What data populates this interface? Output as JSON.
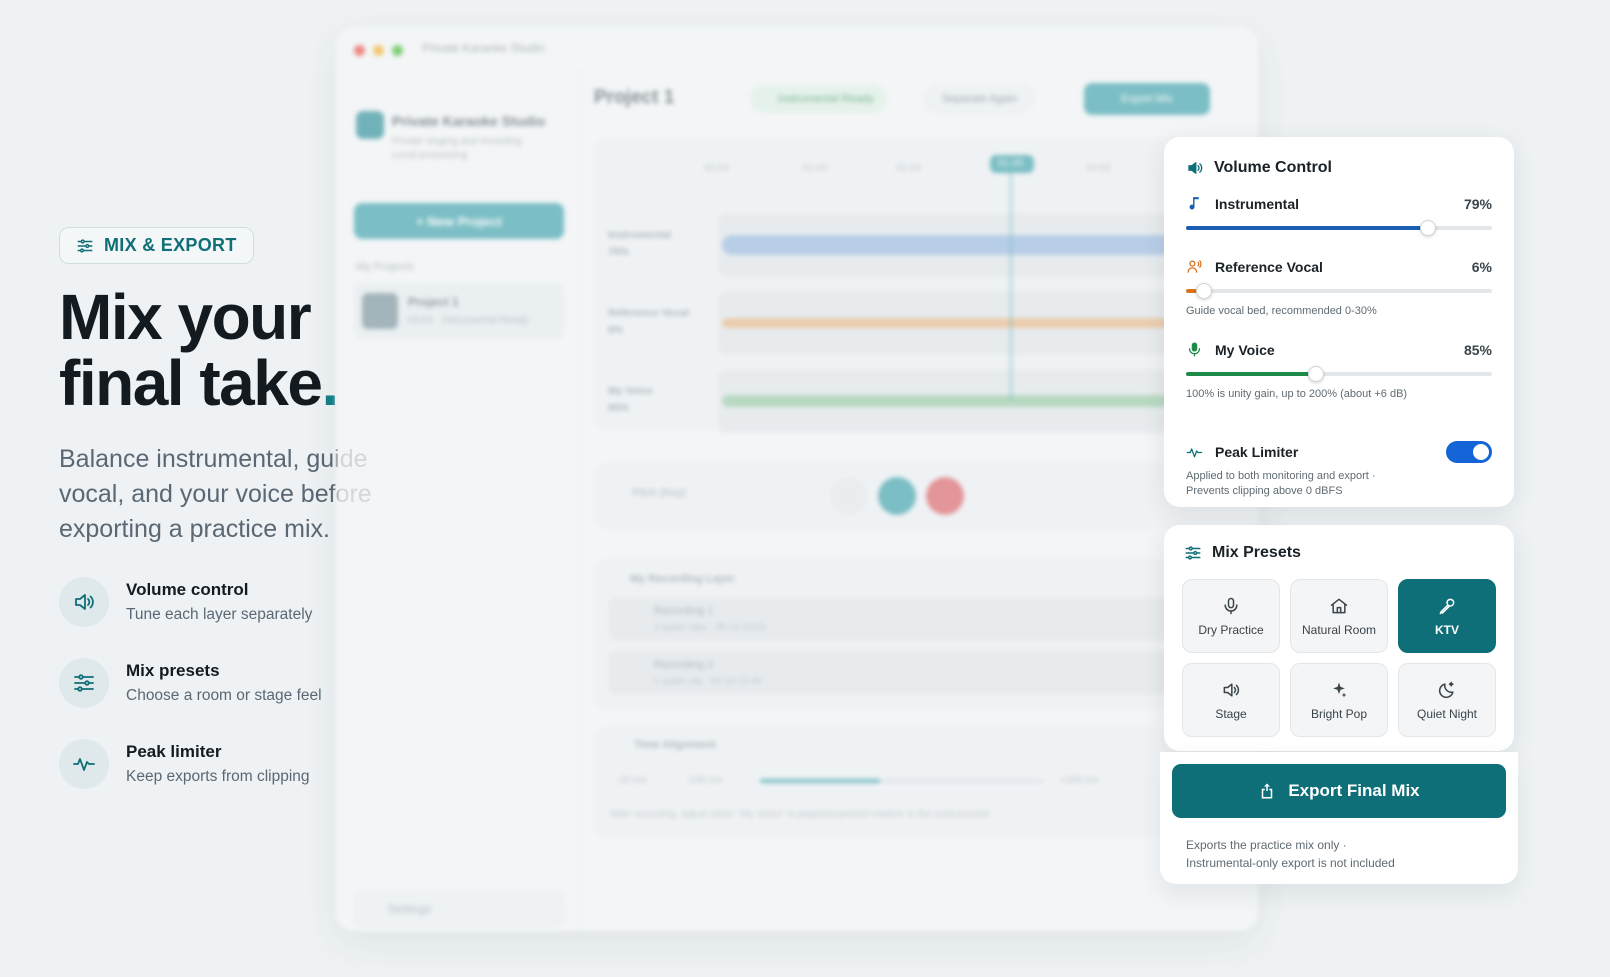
{
  "hero": {
    "eyebrow": "MIX & EXPORT",
    "headline_line1": "Mix your",
    "headline_line2": "final take",
    "headline_dot": ".",
    "subtitle": "Balance instrumental, guide vocal, and your voice before exporting a practice mix.",
    "features": [
      {
        "icon": "speaker-icon",
        "title": "Volume control",
        "desc": "Tune each layer separately"
      },
      {
        "icon": "sliders-icon",
        "title": "Mix presets",
        "desc": "Choose a room or stage feel"
      },
      {
        "icon": "pulse-icon",
        "title": "Peak limiter",
        "desc": "Keep exports from clipping"
      }
    ]
  },
  "app": {
    "window_title": "Private Karaoke Studio",
    "brand_name": "Private Karaoke Studio",
    "brand_sub1": "Private singing and recording",
    "brand_sub2": "Local processing",
    "new_project": "+ New Project",
    "my_projects": "My Projects",
    "project_item": {
      "name": "Project 1",
      "meta": "03:04 · Instrumental Ready"
    },
    "settings": "Settings",
    "project_title": "Project 1",
    "status_chip": "Instrumental Ready",
    "separate_again": "Separate Again",
    "export_mix": "Export Mix",
    "ticks": [
      "00:00",
      "01:00",
      "02:00",
      "01:20",
      "04:00"
    ],
    "tracks": [
      {
        "name": "Instrumental",
        "pct": "79%"
      },
      {
        "name": "Reference Vocal",
        "pct": "6%"
      },
      {
        "name": "My Voice",
        "pct": "85%"
      }
    ],
    "pitch_label": "Pitch (Key)",
    "recording_layer": "My Recording Layer",
    "recordings": [
      {
        "name": "Recording 1",
        "meta": "2 audio clips · 05-19 23:02"
      },
      {
        "name": "Recording 2",
        "meta": "1 audio clip · 05-19 22:40"
      }
    ],
    "time_alignment": "Time Alignment",
    "align_left1": "-10 ms",
    "align_left2": "-100 ms",
    "align_right": "+100 ms",
    "align_note": "After recording, adjust when \"My Voice\" is played/exported relative to the instrumental"
  },
  "volume": {
    "title": "Volume Control",
    "rows": [
      {
        "name": "Instrumental",
        "value": "79%",
        "level": 0.79,
        "color": "#1a5fb4",
        "icon": "music-note-icon"
      },
      {
        "name": "Reference Vocal",
        "value": "6%",
        "level": 0.06,
        "color": "#d9731c",
        "icon": "people-voice-icon",
        "hint": "Guide vocal bed, recommended 0-30%"
      },
      {
        "name": "My Voice",
        "value": "85%",
        "level": 0.425,
        "color": "#1e8a4a",
        "icon": "microphone-icon",
        "hint": "100% is unity gain, up to 200% (about +6 dB)"
      }
    ],
    "limiter": {
      "name": "Peak Limiter",
      "on": true,
      "desc_line1": "Applied to both monitoring and export ·",
      "desc_line2": "Prevents clipping above 0 dBFS"
    }
  },
  "presets": {
    "title": "Mix Presets",
    "items": [
      {
        "label": "Dry Practice",
        "icon": "microphone-icon",
        "active": false
      },
      {
        "label": "Natural Room",
        "icon": "home-icon",
        "active": false
      },
      {
        "label": "KTV",
        "icon": "karaoke-mic-icon",
        "active": true
      },
      {
        "label": "Stage",
        "icon": "speaker-icon",
        "active": false
      },
      {
        "label": "Bright Pop",
        "icon": "sparkle-icon",
        "active": false
      },
      {
        "label": "Quiet Night",
        "icon": "moon-icon",
        "active": false
      }
    ]
  },
  "export": {
    "button": "Export Final Mix",
    "note_line1": "Exports the practice mix only ·",
    "note_line2": "Instrumental-only export is not included"
  },
  "colors": {
    "accent": "#0f6f78",
    "instrumental": "#1a5fb4",
    "reference": "#d9731c",
    "voice": "#1e8a4a",
    "toggle": "#1565d8"
  }
}
